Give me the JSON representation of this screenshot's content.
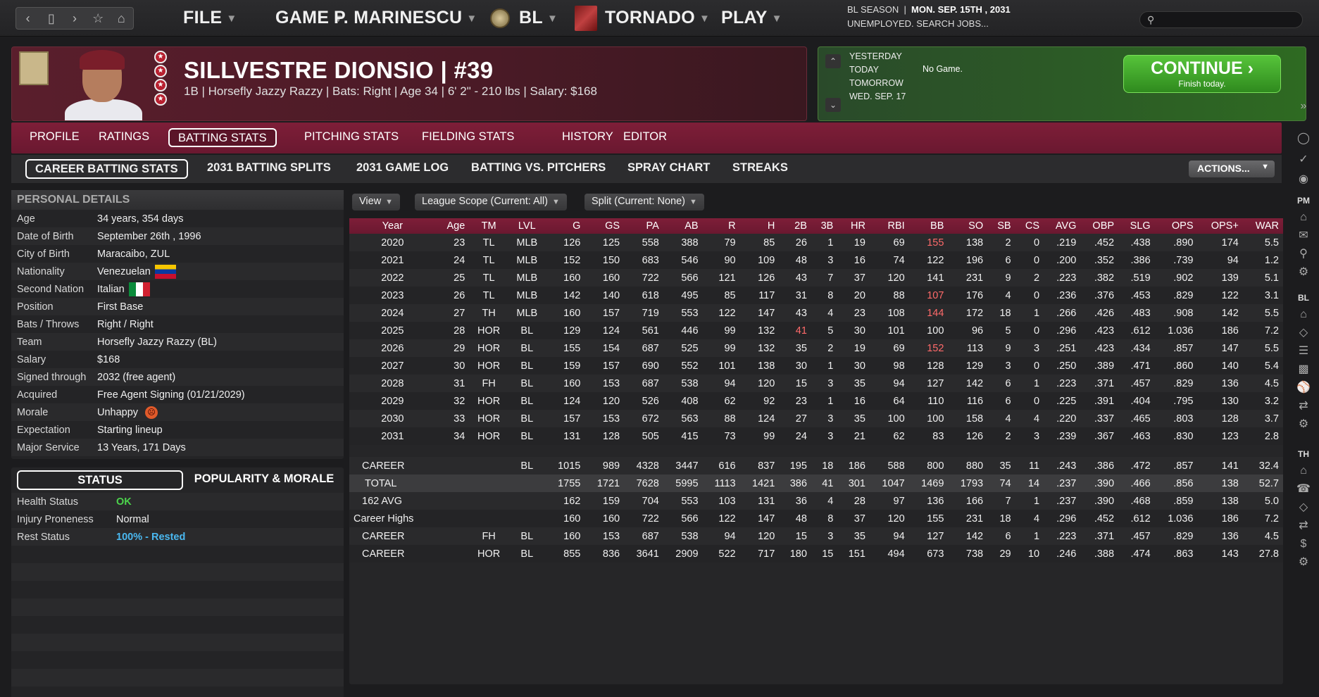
{
  "topbar": {
    "menus": [
      "FILE",
      "GAME",
      "P. MARINESCU",
      "BL",
      "TORNADO",
      "PLAY"
    ],
    "season_label": "BL SEASON",
    "date": "MON. SEP. 15TH , 2031",
    "status": "UNEMPLOYED. SEARCH JOBS...",
    "search_placeholder": ""
  },
  "player": {
    "name_number": "SILLVESTRE DIONSIO  |  #39",
    "info": "1B | Horsefly Jazzy Razzy  |  Bats: Right  |  Age 34  |  6' 2\" - 210 lbs  |  Salary: $168"
  },
  "schedule": {
    "days": [
      "YESTERDAY",
      "TODAY",
      "TOMORROW",
      "WED. SEP. 17"
    ],
    "today_text": "No Game.",
    "continue_label": "CONTINUE",
    "continue_sub": "Finish today."
  },
  "tabs": {
    "main": [
      "PROFILE",
      "RATINGS",
      "BATTING STATS",
      "PITCHING STATS",
      "FIELDING STATS",
      "HISTORY",
      "EDITOR"
    ],
    "sub": [
      "CAREER BATTING STATS",
      "2031 BATTING SPLITS",
      "2031 GAME LOG",
      "BATTING VS. PITCHERS",
      "SPRAY CHART",
      "STREAKS"
    ],
    "actions": "ACTIONS..."
  },
  "personal": {
    "title": "PERSONAL DETAILS",
    "rows": [
      {
        "k": "Age",
        "v": "34 years, 354 days"
      },
      {
        "k": "Date of Birth",
        "v": "September 26th , 1996"
      },
      {
        "k": "City of Birth",
        "v": "Maracaibo, ZUL"
      },
      {
        "k": "Nationality",
        "v": "Venezuelan"
      },
      {
        "k": "Second Nation",
        "v": "Italian"
      },
      {
        "k": "Position",
        "v": "First Base"
      },
      {
        "k": "Bats / Throws",
        "v": "Right / Right"
      },
      {
        "k": "Team",
        "v": "Horsefly Jazzy Razzy (BL)"
      },
      {
        "k": "Salary",
        "v": "$168"
      },
      {
        "k": "Signed through",
        "v": "2032 (free agent)"
      },
      {
        "k": "Acquired",
        "v": "Free Agent Signing (01/21/2029)"
      },
      {
        "k": "Morale",
        "v": "Unhappy"
      },
      {
        "k": "Expectation",
        "v": "Starting lineup"
      },
      {
        "k": "Major Service",
        "v": "13 Years, 171 Days"
      }
    ]
  },
  "status": {
    "tab_status": "STATUS",
    "tab_popularity": "POPULARITY & MORALE",
    "rows": [
      {
        "k": "Health Status",
        "v": "OK",
        "color": "#4cd44c"
      },
      {
        "k": "Injury Proneness",
        "v": "Normal",
        "color": "#f0f0f0"
      },
      {
        "k": "Rest Status",
        "v": "100% - Rested",
        "color": "#4ab8f0"
      }
    ]
  },
  "filters": [
    "View",
    "League Scope (Current: All)",
    "Split  (Current: None)"
  ],
  "table": {
    "headers": [
      "Year",
      "Age",
      "TM",
      "LVL",
      "G",
      "GS",
      "PA",
      "AB",
      "R",
      "H",
      "2B",
      "3B",
      "HR",
      "RBI",
      "BB",
      "SO",
      "SB",
      "CS",
      "AVG",
      "OBP",
      "SLG",
      "OPS",
      "OPS+",
      "WAR"
    ],
    "rows": [
      [
        "2020",
        "23",
        "TL",
        "MLB",
        "126",
        "125",
        "558",
        "388",
        "79",
        "85",
        "26",
        "1",
        "19",
        "69",
        "155",
        "138",
        "2",
        "0",
        ".219",
        ".452",
        ".438",
        ".890",
        "174",
        "5.5"
      ],
      [
        "2021",
        "24",
        "TL",
        "MLB",
        "152",
        "150",
        "683",
        "546",
        "90",
        "109",
        "48",
        "3",
        "16",
        "74",
        "122",
        "196",
        "6",
        "0",
        ".200",
        ".352",
        ".386",
        ".739",
        "94",
        "1.2"
      ],
      [
        "2022",
        "25",
        "TL",
        "MLB",
        "160",
        "160",
        "722",
        "566",
        "121",
        "126",
        "43",
        "7",
        "37",
        "120",
        "141",
        "231",
        "9",
        "2",
        ".223",
        ".382",
        ".519",
        ".902",
        "139",
        "5.1"
      ],
      [
        "2023",
        "26",
        "TL",
        "MLB",
        "142",
        "140",
        "618",
        "495",
        "85",
        "117",
        "31",
        "8",
        "20",
        "88",
        "107",
        "176",
        "4",
        "0",
        ".236",
        ".376",
        ".453",
        ".829",
        "122",
        "3.1"
      ],
      [
        "2024",
        "27",
        "TH",
        "MLB",
        "160",
        "157",
        "719",
        "553",
        "122",
        "147",
        "43",
        "4",
        "23",
        "108",
        "144",
        "172",
        "18",
        "1",
        ".266",
        ".426",
        ".483",
        ".908",
        "142",
        "5.5"
      ],
      [
        "2025",
        "28",
        "HOR",
        "BL",
        "129",
        "124",
        "561",
        "446",
        "99",
        "132",
        "41",
        "5",
        "30",
        "101",
        "100",
        "96",
        "5",
        "0",
        ".296",
        ".423",
        ".612",
        "1.036",
        "186",
        "7.2"
      ],
      [
        "2026",
        "29",
        "HOR",
        "BL",
        "155",
        "154",
        "687",
        "525",
        "99",
        "132",
        "35",
        "2",
        "19",
        "69",
        "152",
        "113",
        "9",
        "3",
        ".251",
        ".423",
        ".434",
        ".857",
        "147",
        "5.5"
      ],
      [
        "2027",
        "30",
        "HOR",
        "BL",
        "159",
        "157",
        "690",
        "552",
        "101",
        "138",
        "30",
        "1",
        "30",
        "98",
        "128",
        "129",
        "3",
        "0",
        ".250",
        ".389",
        ".471",
        ".860",
        "140",
        "5.4"
      ],
      [
        "2028",
        "31",
        "FH",
        "BL",
        "160",
        "153",
        "687",
        "538",
        "94",
        "120",
        "15",
        "3",
        "35",
        "94",
        "127",
        "142",
        "6",
        "1",
        ".223",
        ".371",
        ".457",
        ".829",
        "136",
        "4.5"
      ],
      [
        "2029",
        "32",
        "HOR",
        "BL",
        "124",
        "120",
        "526",
        "408",
        "62",
        "92",
        "23",
        "1",
        "16",
        "64",
        "110",
        "116",
        "6",
        "0",
        ".225",
        ".391",
        ".404",
        ".795",
        "130",
        "3.2"
      ],
      [
        "2030",
        "33",
        "HOR",
        "BL",
        "157",
        "153",
        "672",
        "563",
        "88",
        "124",
        "27",
        "3",
        "35",
        "100",
        "100",
        "158",
        "4",
        "4",
        ".220",
        ".337",
        ".465",
        ".803",
        "128",
        "3.7"
      ],
      [
        "2031",
        "34",
        "HOR",
        "BL",
        "131",
        "128",
        "505",
        "415",
        "73",
        "99",
        "24",
        "3",
        "21",
        "62",
        "83",
        "126",
        "2",
        "3",
        ".239",
        ".367",
        ".463",
        ".830",
        "123",
        "2.8"
      ]
    ],
    "highlights": [
      [
        0,
        14
      ],
      [
        3,
        14
      ],
      [
        4,
        14
      ],
      [
        5,
        10
      ],
      [
        6,
        14
      ]
    ],
    "summary": [
      [
        "CAREER",
        "",
        "",
        "BL",
        "1015",
        "989",
        "4328",
        "3447",
        "616",
        "837",
        "195",
        "18",
        "186",
        "588",
        "800",
        "880",
        "35",
        "11",
        ".243",
        ".386",
        ".472",
        ".857",
        "141",
        "32.4"
      ],
      [
        "TOTAL",
        "",
        "",
        "",
        "1755",
        "1721",
        "7628",
        "5995",
        "1113",
        "1421",
        "386",
        "41",
        "301",
        "1047",
        "1469",
        "1793",
        "74",
        "14",
        ".237",
        ".390",
        ".466",
        ".856",
        "138",
        "52.7"
      ],
      [
        "162 AVG",
        "",
        "",
        "",
        "162",
        "159",
        "704",
        "553",
        "103",
        "131",
        "36",
        "4",
        "28",
        "97",
        "136",
        "166",
        "7",
        "1",
        ".237",
        ".390",
        ".468",
        ".859",
        "138",
        "5.0"
      ],
      [
        "Career Highs",
        "",
        "",
        "",
        "160",
        "160",
        "722",
        "566",
        "122",
        "147",
        "48",
        "8",
        "37",
        "120",
        "155",
        "231",
        "18",
        "4",
        ".296",
        ".452",
        ".612",
        "1.036",
        "186",
        "7.2"
      ],
      [
        "CAREER",
        "",
        "FH",
        "BL",
        "160",
        "153",
        "687",
        "538",
        "94",
        "120",
        "15",
        "3",
        "35",
        "94",
        "127",
        "142",
        "6",
        "1",
        ".223",
        ".371",
        ".457",
        ".829",
        "136",
        "4.5"
      ],
      [
        "CAREER",
        "",
        "HOR",
        "BL",
        "855",
        "836",
        "3641",
        "2909",
        "522",
        "717",
        "180",
        "15",
        "151",
        "494",
        "673",
        "738",
        "29",
        "10",
        ".246",
        ".388",
        ".474",
        ".863",
        "143",
        "27.8"
      ]
    ]
  },
  "sidebar": {
    "labels": [
      "PM",
      "BL",
      "TH"
    ]
  },
  "colors": {
    "accent": "#7e1e38",
    "highlight_red": "#ff6a6a",
    "continue_green": "#3fa82a"
  }
}
